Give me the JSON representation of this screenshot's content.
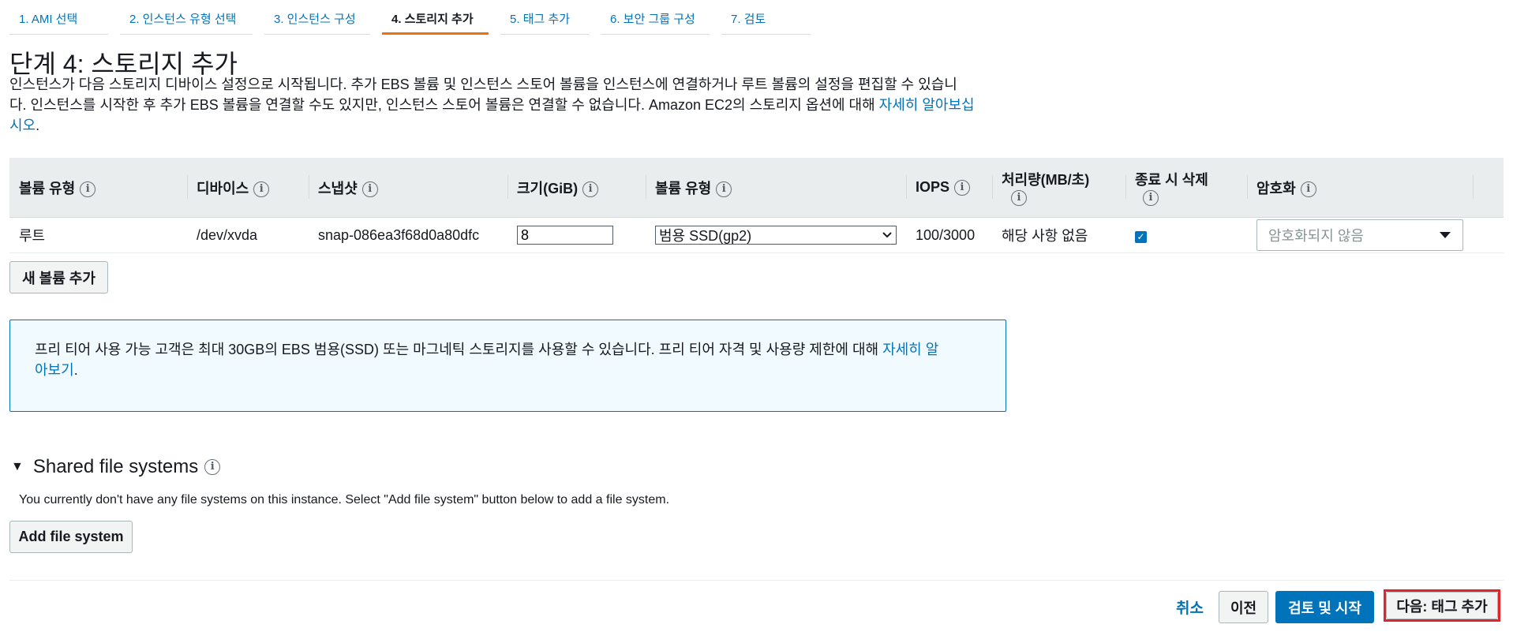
{
  "tabs": [
    "1. AMI 선택",
    "2. 인스턴스 유형 선택",
    "3. 인스턴스 구성",
    "4. 스토리지 추가",
    "5. 태그 추가",
    "6. 보안 그룹 구성",
    "7. 검토"
  ],
  "page": {
    "title": "단계 4: 스토리지 추가",
    "description_line1": "인스턴스가 다음 스토리지 디바이스 설정으로 시작됩니다. 추가 EBS 볼륨 및 인스턴스 스토어 볼륨을 인스턴스에 연결하거나 루트 볼륨의 설정을 편집할 수 있습니",
    "description_line2": "다. 인스턴스를 시작한 후 추가 EBS 볼륨을 연결할 수도 있지만, 인스턴스 스토어 볼륨은 연결할 수 없습니다. Amazon EC2의 스토리지 옵션에 대해 ",
    "description_link_a": "자세히 알아보십",
    "description_link_b": "시오",
    "description_end": "."
  },
  "table": {
    "headers": {
      "volume_type": "볼륨 유형",
      "device": "디바이스",
      "snapshot": "스냅샷",
      "size": "크기(GiB)",
      "ebs_type": "볼륨 유형",
      "iops": "IOPS",
      "throughput": "처리량(MB/초)",
      "delete": "종료 시 삭제",
      "encryption": "암호화"
    },
    "row": {
      "volume_type": "루트",
      "device": "/dev/xvda",
      "snapshot": "snap-086ea3f68d0a80dfc",
      "size": "8",
      "ebs_type": "범용 SSD(gp2)",
      "iops": "100/3000",
      "throughput": "해당 사항 없음",
      "encryption": "암호화되지 않음"
    }
  },
  "buttons": {
    "add_volume": "새 볼륨 추가",
    "add_file_system": "Add file system",
    "cancel": "취소",
    "previous": "이전",
    "review_launch": "검토 및 시작",
    "next": "다음: 태그 추가"
  },
  "free_tier": {
    "text_a": "프리 티어 사용 가능 고객은 최대 30GB의 EBS 범용(SSD) 또는 마그네틱 스토리지를 사용할 수 있습니다. 프리 티어 자격 및 사용량 제한에 대해 ",
    "link_a": "자세히 알",
    "link_b": "아보기",
    "text_end": "."
  },
  "file_systems": {
    "title": "Shared file systems",
    "message": "You currently don't have any file systems on this instance. Select \"Add file system\" button below to add a file system."
  },
  "icons": {
    "info": "info-icon",
    "caret": "caret-down-icon",
    "check": "checkbox-checked-icon"
  },
  "colors": {
    "link": "#0073bb",
    "active_tab": "#ec7211",
    "primary": "#0073bb",
    "highlight": "#e3242b"
  }
}
